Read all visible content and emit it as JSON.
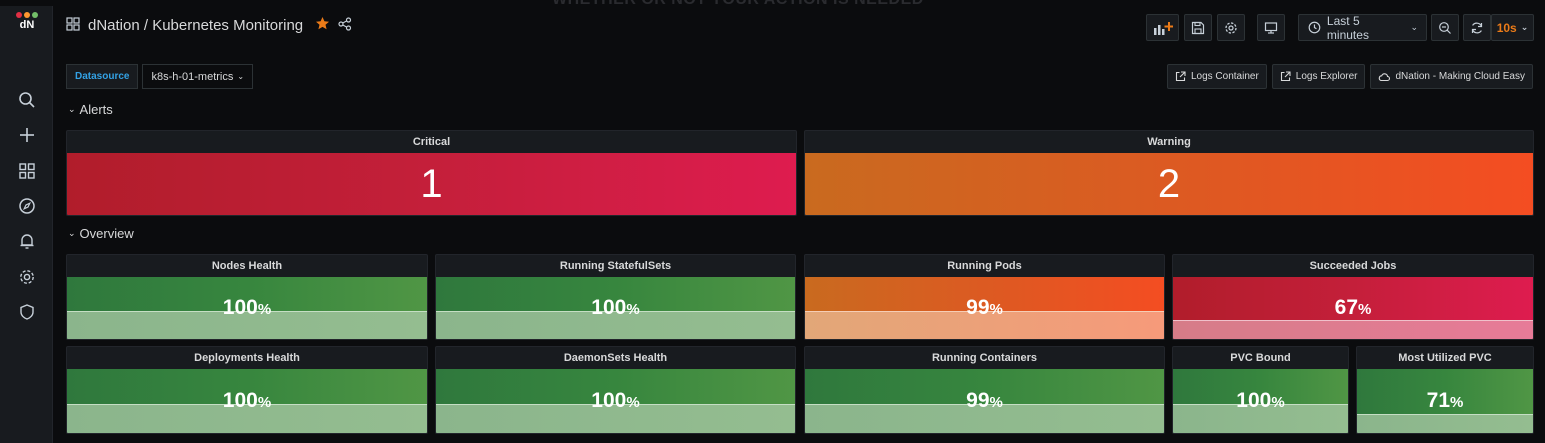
{
  "banner_text": "WHETHER OR NOT YOUR ACTION IS NEEDED",
  "app": {
    "logo_text": "dN",
    "dot_colors": [
      "#e02f44",
      "#ff9830",
      "#73bf69"
    ]
  },
  "sidemenu": {
    "icons": [
      "search-icon",
      "plus-icon",
      "dashboards-icon",
      "explore-icon",
      "alerting-icon",
      "settings-icon",
      "shield-icon"
    ]
  },
  "header": {
    "breadcrumb": "dNation / Kubernetes Monitoring",
    "starred": true,
    "time_range": "Last 5 minutes",
    "refresh_interval": "10s"
  },
  "variables": {
    "datasource_label": "Datasource",
    "datasource_value": "k8s-h-01-metrics"
  },
  "links": [
    {
      "label": "Logs Container",
      "icon": "external-link-icon"
    },
    {
      "label": "Logs Explorer",
      "icon": "external-link-icon"
    },
    {
      "label": "dNation - Making Cloud Easy",
      "icon": "cloud-icon"
    }
  ],
  "rows": {
    "alerts": "Alerts",
    "overview": "Overview"
  },
  "alerts": [
    {
      "title": "Critical",
      "value": "1",
      "color": "#c41f3a"
    },
    {
      "title": "Warning",
      "value": "2",
      "color": "#e55a22"
    }
  ],
  "overview": [
    {
      "title": "Nodes Health",
      "value": "100",
      "unit": "%",
      "fill": 0.45,
      "color": "green"
    },
    {
      "title": "Running StatefulSets",
      "value": "100",
      "unit": "%",
      "fill": 0.45,
      "color": "green"
    },
    {
      "title": "Running Pods",
      "value": "99",
      "unit": "%",
      "fill": 0.45,
      "color": "orange"
    },
    {
      "title": "Succeeded Jobs",
      "value": "67",
      "unit": "%",
      "fill": 0.3,
      "color": "red"
    },
    {
      "title": "Deployments Health",
      "value": "100",
      "unit": "%",
      "fill": 0.45,
      "color": "green"
    },
    {
      "title": "DaemonSets Health",
      "value": "100",
      "unit": "%",
      "fill": 0.45,
      "color": "green"
    },
    {
      "title": "Running Containers",
      "value": "99",
      "unit": "%",
      "fill": 0.45,
      "color": "green"
    },
    {
      "title": "PVC Bound",
      "value": "100",
      "unit": "%",
      "fill": 0.45,
      "color": "green"
    },
    {
      "title": "Most Utilized PVC",
      "value": "71",
      "unit": "%",
      "fill": 0.3,
      "color": "green"
    }
  ]
}
